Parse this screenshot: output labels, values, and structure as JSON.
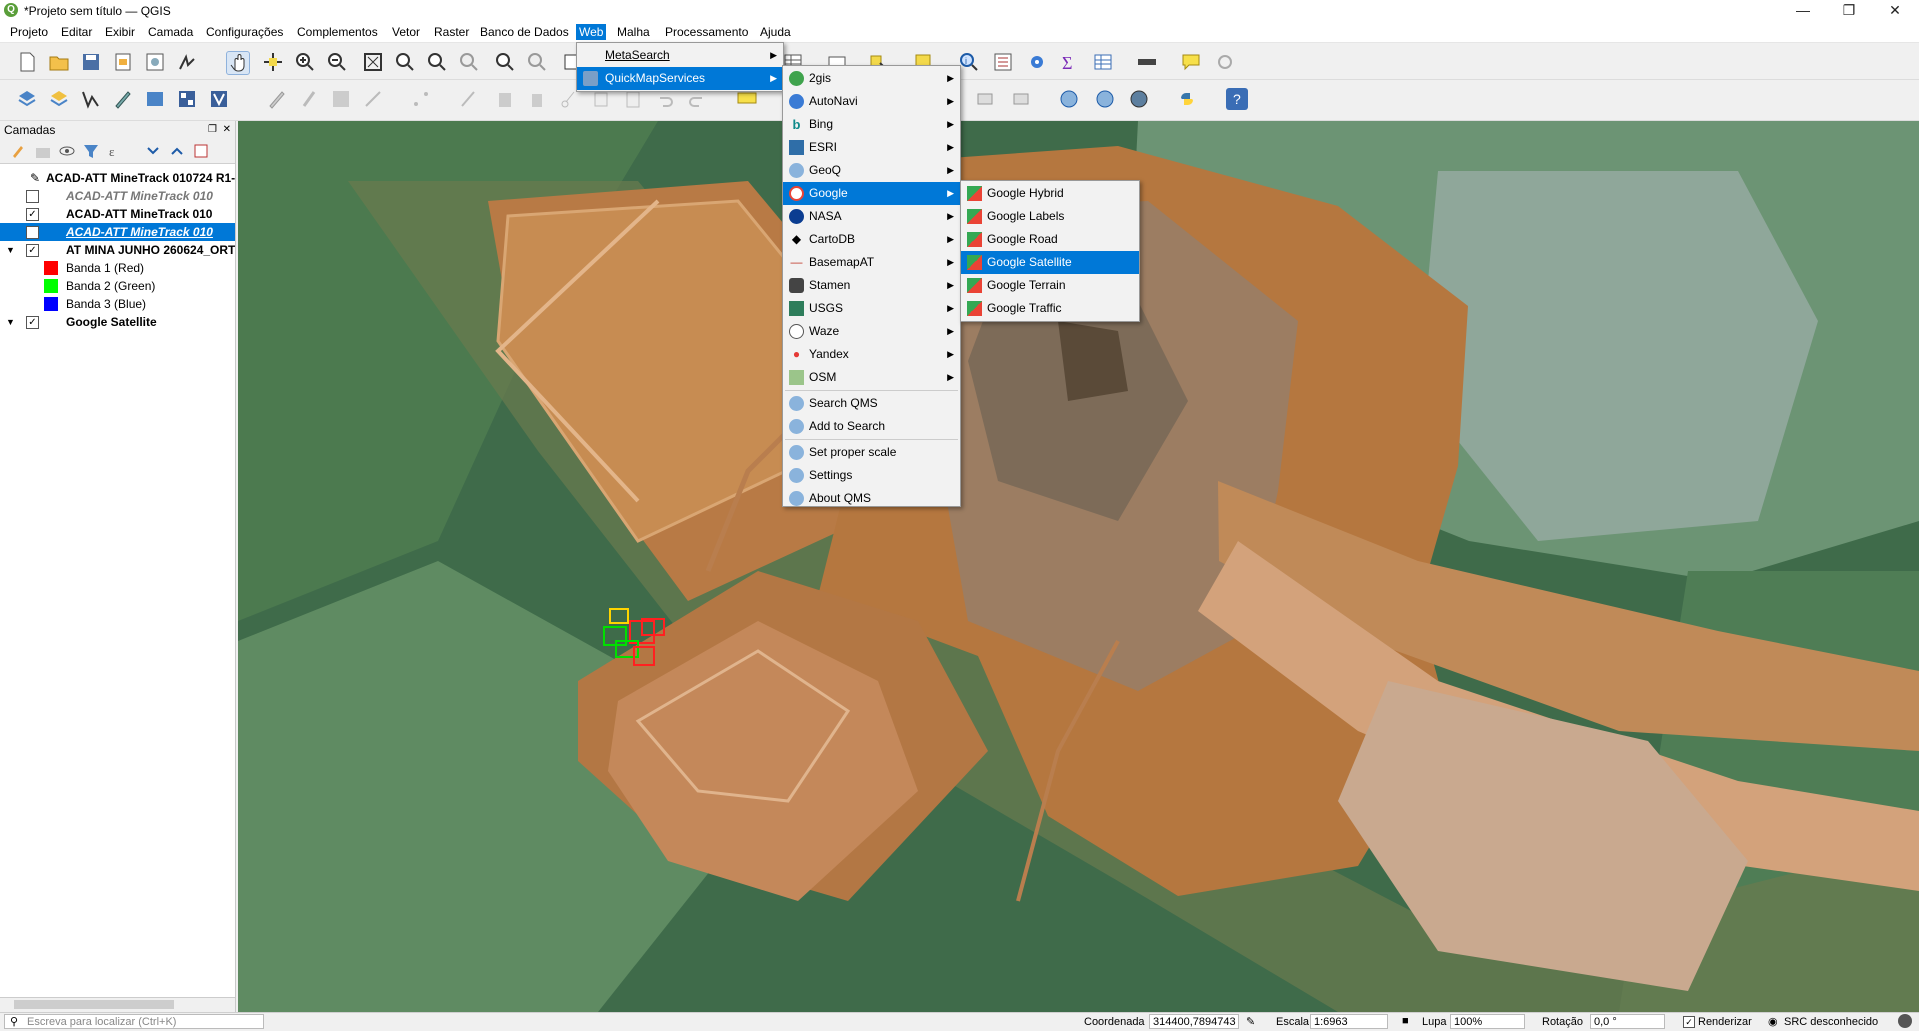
{
  "window": {
    "title": "*Projeto sem título — QGIS"
  },
  "menubar": [
    "Projeto",
    "Editar",
    "Exibir",
    "Camada",
    "Configurações",
    "Complementos",
    "Vetor",
    "Raster",
    "Banco de Dados",
    "Web",
    "Malha",
    "Processamento",
    "Ajuda"
  ],
  "layers_panel": {
    "title": "Camadas",
    "layers": [
      {
        "name": "ACAD-ATT MineTrack 010724 R1-",
        "checked": null
      },
      {
        "name": "ACAD-ATT MineTrack 010",
        "checked": false
      },
      {
        "name": "ACAD-ATT MineTrack 010",
        "checked": true
      },
      {
        "name": "ACAD-ATT MineTrack 010",
        "checked": false
      },
      {
        "name": "AT MINA JUNHO 260624_ORT",
        "checked": true
      },
      {
        "name": "Banda 1 (Red)",
        "color": "#ff0000"
      },
      {
        "name": "Banda 2 (Green)",
        "color": "#00ff00"
      },
      {
        "name": "Banda 3 (Blue)",
        "color": "#0000ff"
      },
      {
        "name": "Google Satellite",
        "checked": true
      }
    ]
  },
  "web_menu": {
    "items": [
      "MetaSearch",
      "QuickMapServices"
    ]
  },
  "qms_menu": {
    "providers": [
      "2gis",
      "AutoNavi",
      "Bing",
      "ESRI",
      "GeoQ",
      "Google",
      "NASA",
      "CartoDB",
      "BasemapAT",
      "Stamen",
      "USGS",
      "Waze",
      "Yandex",
      "OSM"
    ],
    "actions": [
      "Search QMS",
      "Add to Search",
      "Set proper scale",
      "Settings",
      "About QMS"
    ]
  },
  "google_menu": {
    "items": [
      "Google Hybrid",
      "Google Labels",
      "Google Road",
      "Google Satellite",
      "Google Terrain",
      "Google Traffic"
    ]
  },
  "statusbar": {
    "search_placeholder": "Escreva para localizar (Ctrl+K)",
    "coord_label": "Coordenada",
    "coord_value": "314400,7894743",
    "scale_label": "Escala",
    "scale_value": "1:6963",
    "magnifier_label": "Lupa",
    "magnifier_value": "100%",
    "rotation_label": "Rotação",
    "rotation_value": "0,0 °",
    "render_label": "Renderizar",
    "crs_label": "SRC desconhecido"
  },
  "colors": {
    "accent": "#0078d7"
  }
}
